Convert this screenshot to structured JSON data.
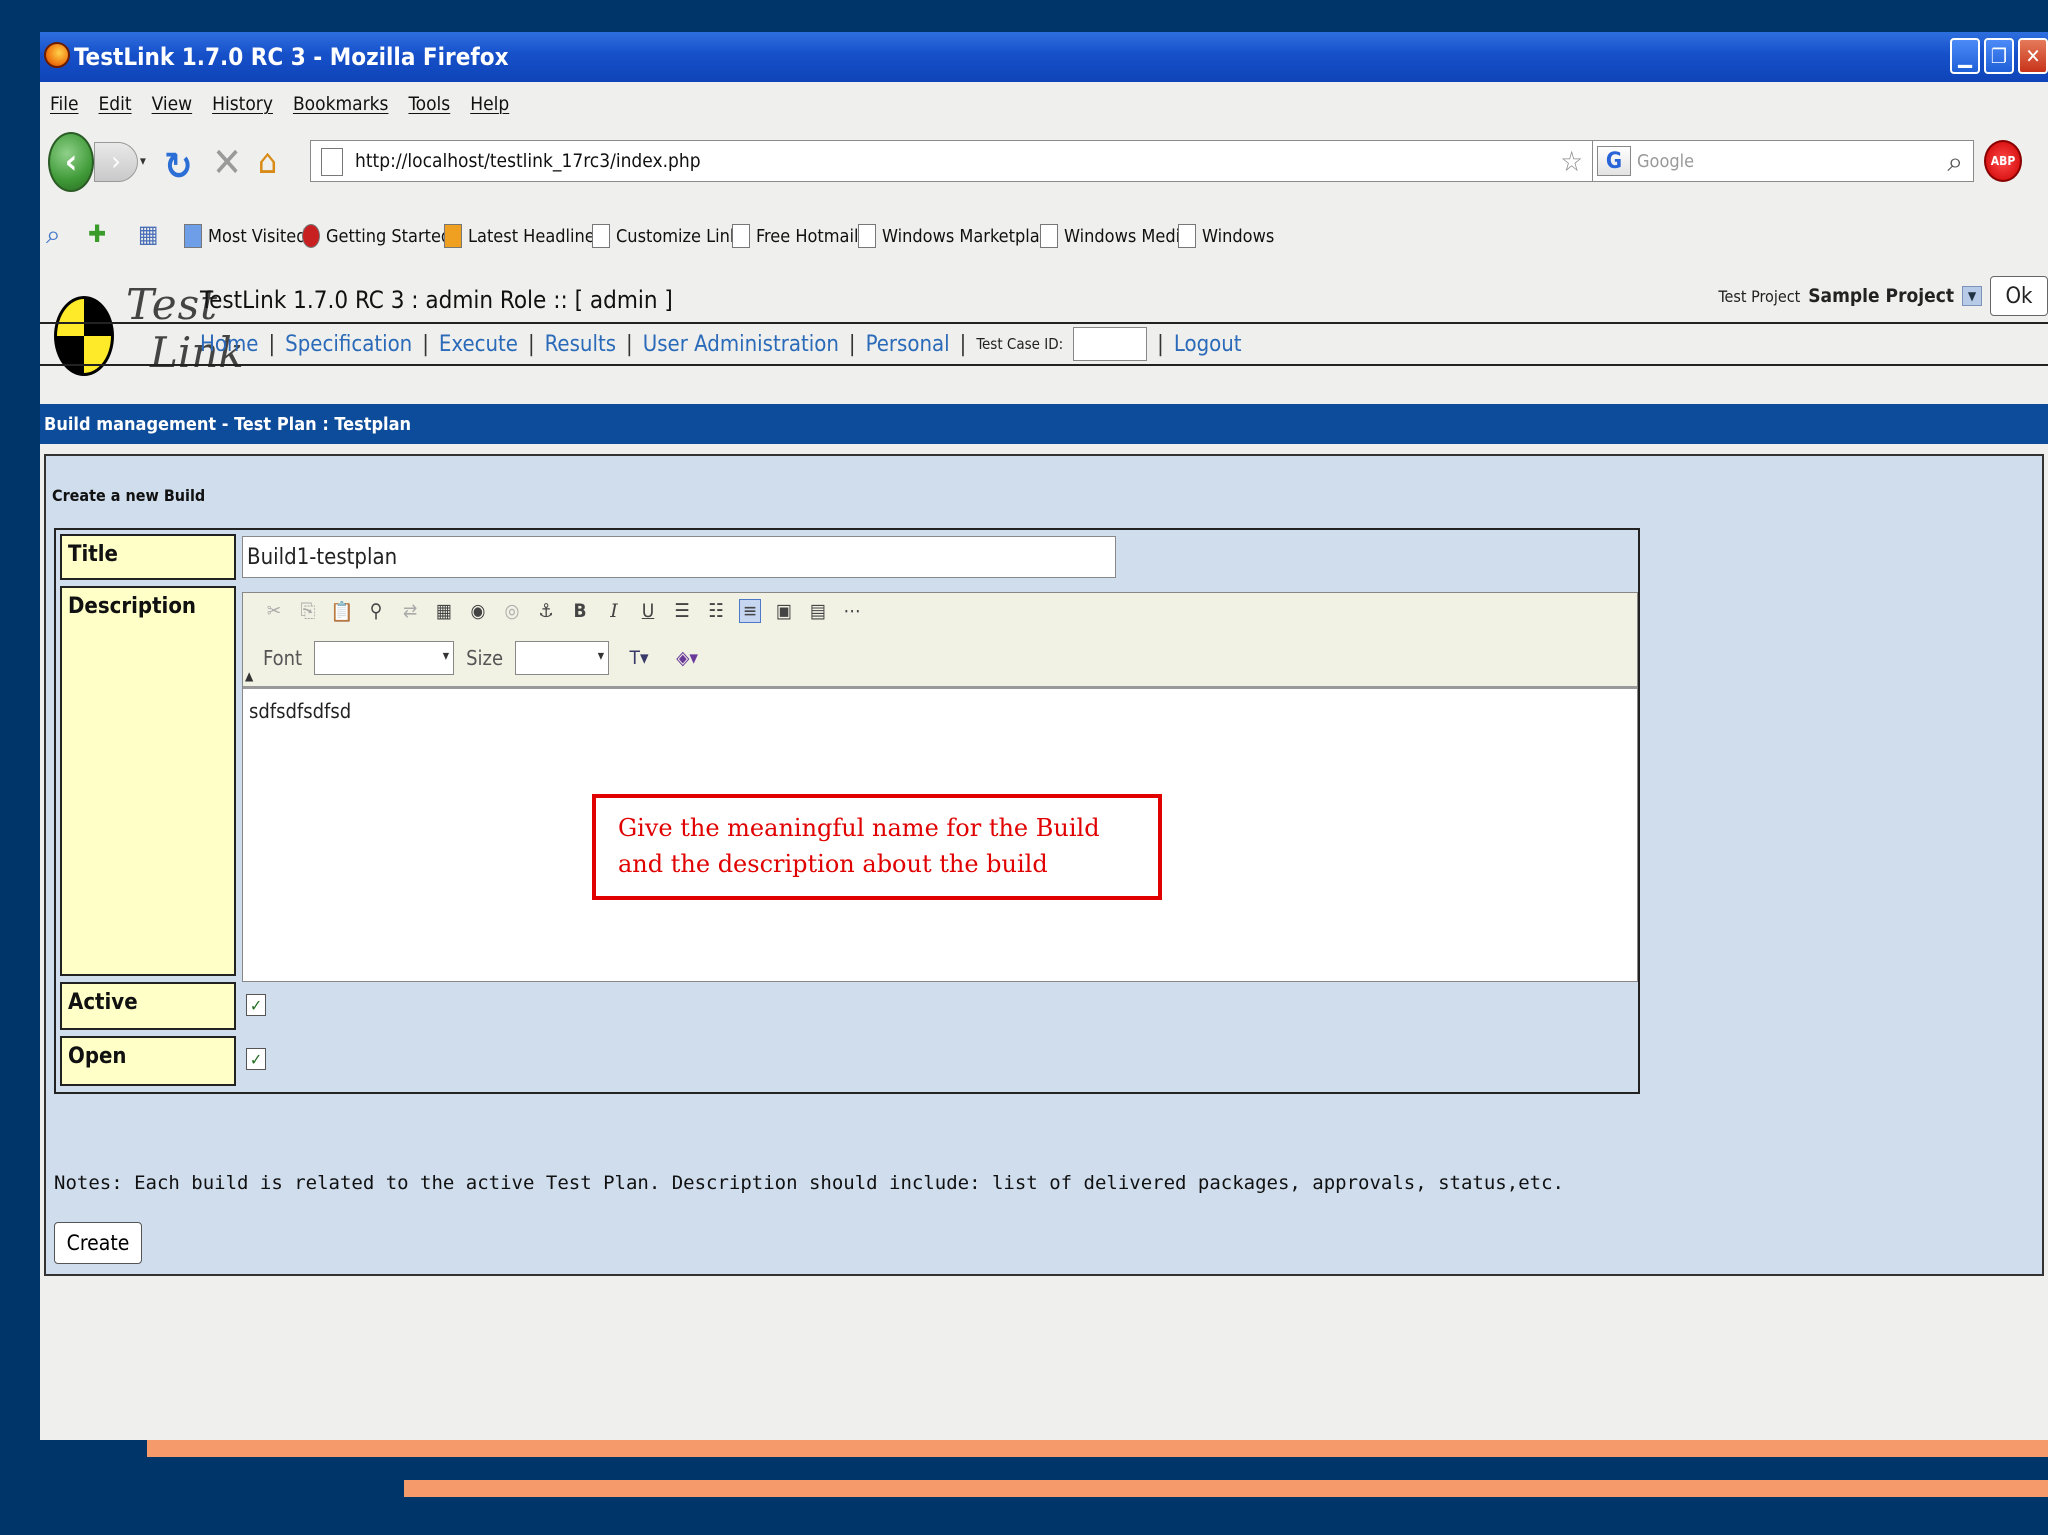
{
  "window": {
    "title": "TestLink 1.7.0 RC 3 - Mozilla Firefox"
  },
  "menu": [
    "File",
    "Edit",
    "View",
    "History",
    "Bookmarks",
    "Tools",
    "Help"
  ],
  "nav": {
    "url": "http://localhost/testlink_17rc3/index.php",
    "search_placeholder": "Google",
    "search_engine_icon": "G"
  },
  "bookmarks": [
    "Most Visited",
    "Getting Started",
    "Latest Headlines",
    "Customize Links",
    "Free Hotmail",
    "Windows Marketplace",
    "Windows Media",
    "Windows"
  ],
  "testlink": {
    "logo_line1": "Test",
    "logo_line2": "Link",
    "header_title": "TestLink 1.7.0 RC 3 : admin Role :: [ admin ]",
    "project_label": "Test Project",
    "project_name": "Sample Project",
    "ok_label": "Ok",
    "nav_links": [
      "Home",
      "Specification",
      "Execute",
      "Results",
      "User Administration",
      "Personal"
    ],
    "test_case_id_label": "Test Case ID:",
    "logout_label": "Logout"
  },
  "page": {
    "bar_title": "Build management - Test Plan : Testplan",
    "section_title": "Create a new Build",
    "labels": {
      "title": "Title",
      "description": "Description",
      "active": "Active",
      "open": "Open"
    },
    "title_value": "Build1-testplan",
    "editor": {
      "font_label": "Font",
      "size_label": "Size",
      "content": "sdfsdfsdfsd"
    },
    "active_checked": true,
    "open_checked": true,
    "notes": "Notes: Each build is related to the active Test Plan. Description should include: list of delivered packages, approvals, status,etc.",
    "create_label": "Create"
  },
  "callout": "Give the meaningful name for the Build and the description about the build",
  "colors": {
    "slide_bg": "#00356a",
    "stripe": "#f59a6b",
    "title_bar": "#1650c9",
    "tl_bar": "#0d4c9a",
    "panel": "#cfdded",
    "label_bg": "#ffffc8",
    "callout": "#e00000"
  }
}
